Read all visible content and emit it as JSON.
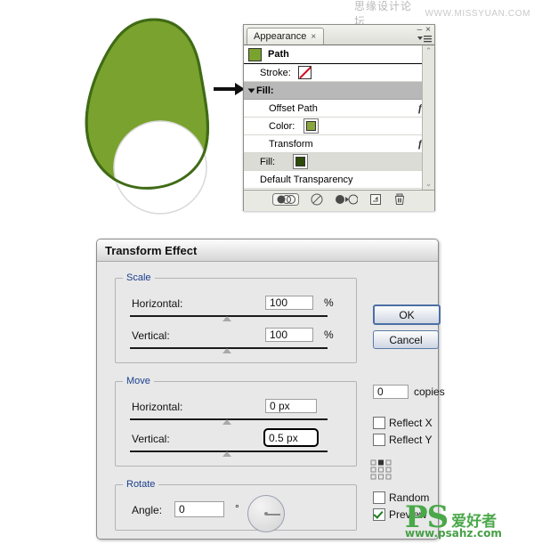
{
  "watermark": {
    "cn": "思缘设计论坛",
    "url": "WWW.MISSYUAN.COM"
  },
  "logo": {
    "ps": "PS",
    "cn": "爱好者",
    "url": "www.psahz.com"
  },
  "illustration": {
    "name": "avocado-shape-preview",
    "fill_color": "#7aa22e",
    "stroke_color": "#3f6b15",
    "circle_color": "#ffffff",
    "arrow": "→"
  },
  "appearance_panel": {
    "tab_label": "Appearance",
    "tab_close": "×",
    "minimize": "–",
    "close": "×",
    "menu_icon": "panel-menu-icon",
    "rows": [
      {
        "label": "Path",
        "type": "header",
        "swatch": "#7aa22e",
        "fx": ""
      },
      {
        "label": "Stroke:",
        "type": "stroke",
        "swatch": "none",
        "fx": ""
      },
      {
        "label": "Fill:",
        "type": "group",
        "selected": true,
        "fx": ""
      },
      {
        "label": "Offset Path",
        "type": "sub",
        "fx": "fx"
      },
      {
        "label": "Color:",
        "type": "sub",
        "swatch": "#8aa63c",
        "fx": ""
      },
      {
        "label": "Transform",
        "type": "sub",
        "fx": "fx"
      },
      {
        "label": "Fill:",
        "type": "fill2",
        "swatch": "#2d4a08",
        "fx": ""
      },
      {
        "label": "Default Transparency",
        "type": "plain",
        "fx": ""
      }
    ],
    "toolbar_icons": [
      "new-art-basic-appearance-icon",
      "clear-appearance-icon",
      "reduce-to-basic-appearance-icon",
      "duplicate-item-icon",
      "delete-item-icon"
    ]
  },
  "dialog": {
    "title": "Transform Effect",
    "scale": {
      "legend": "Scale",
      "horizontal_label": "Horizontal:",
      "horizontal_value": "100",
      "horizontal_unit": "%",
      "vertical_label": "Vertical:",
      "vertical_value": "100",
      "vertical_unit": "%"
    },
    "move": {
      "legend": "Move",
      "horizontal_label": "Horizontal:",
      "horizontal_value": "0 px",
      "vertical_label": "Vertical:",
      "vertical_value": "0.5 px"
    },
    "rotate": {
      "legend": "Rotate",
      "angle_label": "Angle:",
      "angle_value": "0",
      "angle_unit": "°"
    },
    "buttons": {
      "ok": "OK",
      "cancel": "Cancel"
    },
    "copies": {
      "value": "0",
      "label": "copies"
    },
    "options": [
      {
        "label": "Reflect X",
        "checked": false
      },
      {
        "label": "Reflect Y",
        "checked": false
      },
      {
        "label": "Random",
        "checked": false
      },
      {
        "label": "Preview",
        "checked": true
      }
    ],
    "anchor": {
      "name": "transform-anchor-grid",
      "selected": "top-center"
    }
  }
}
